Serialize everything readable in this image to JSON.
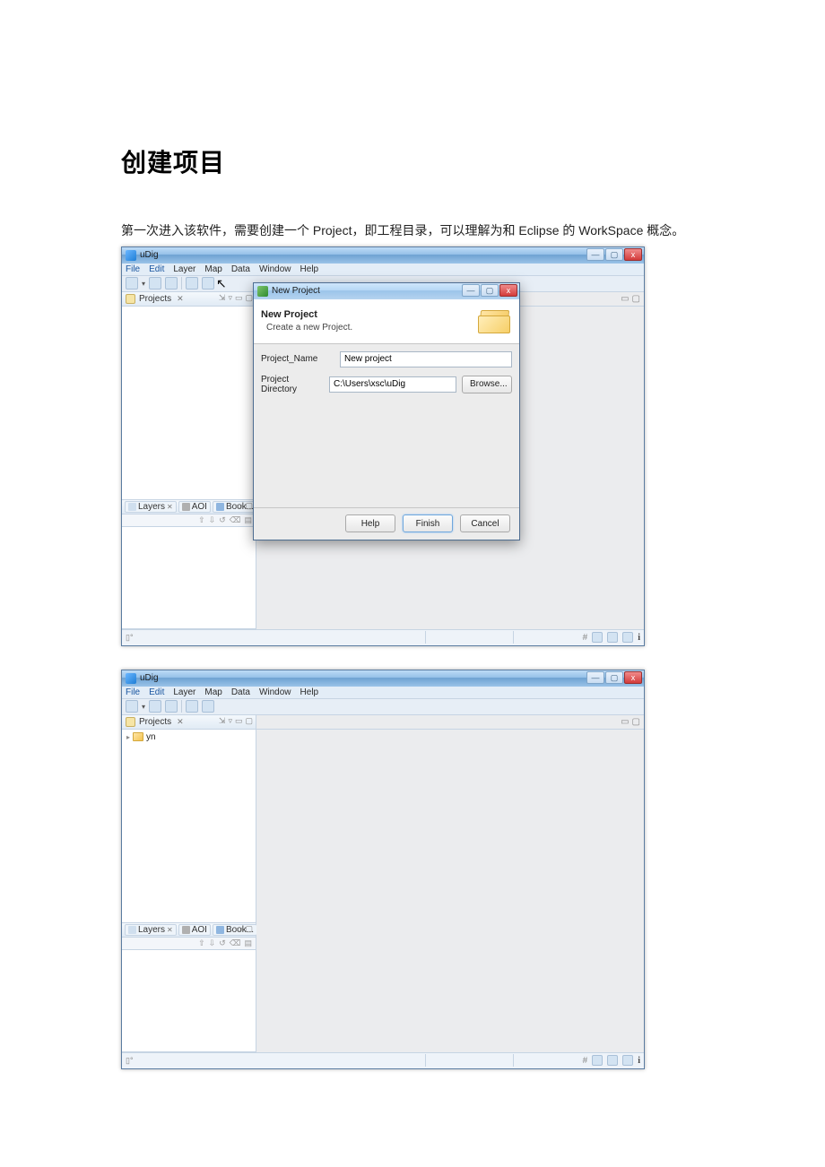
{
  "doc": {
    "heading": "创建项目",
    "paragraph": "第一次进入该软件，需要创建一个 Project，即工程目录，可以理解为和 Eclipse 的 WorkSpace 概念。"
  },
  "app": {
    "title": "uDig",
    "menu": {
      "file": "File",
      "edit": "Edit",
      "layer": "Layer",
      "map": "Map",
      "data": "Data",
      "window": "Window",
      "help": "Help"
    },
    "views": {
      "projects": "Projects",
      "layers": "Layers",
      "aoi": "AOI",
      "bookmarks": "Book..."
    },
    "tree_item": "yn",
    "winbtns": {
      "min": "—",
      "max": "▢",
      "close": "x"
    }
  },
  "dialog": {
    "title": "New Project",
    "header_title": "New Project",
    "header_sub": "Create a new Project.",
    "name_label": "Project_Name",
    "name_value": "New project",
    "dir_label": "Project Directory",
    "dir_value": "C:\\Users\\xsc\\uDig",
    "browse": "Browse...",
    "help": "Help",
    "finish": "Finish",
    "cancel": "Cancel"
  }
}
